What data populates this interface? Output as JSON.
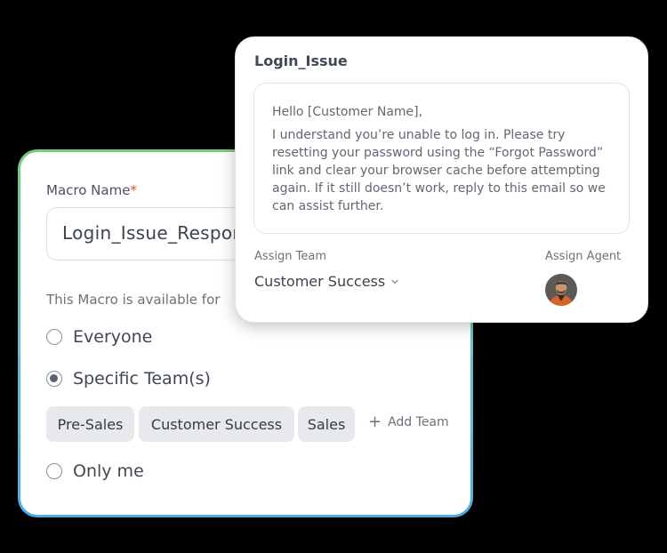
{
  "macro_form": {
    "name_label": "Macro Name",
    "required_mark": "*",
    "name_value": "Login_Issue_Response",
    "availability_label": "This Macro is available for",
    "options": [
      {
        "label": "Everyone",
        "selected": false
      },
      {
        "label": "Specific Team(s)",
        "selected": true
      },
      {
        "label": "Only me",
        "selected": false
      }
    ],
    "teams": [
      "Pre-Sales",
      "Customer Success",
      "Sales"
    ],
    "add_team_label": "Add Team"
  },
  "template": {
    "title": "Login_Issue",
    "greeting": "Hello [Customer Name],",
    "body": "I understand you’re unable to log in. Please try resetting your password using the “Forgot Password” link and clear your browser cache before attempting again. If it still doesn’t work, reply to this email so we can assist further.",
    "assign_team_label": "Assign Team",
    "assign_team_value": "Customer Success",
    "assign_agent_label": "Assign Agent"
  },
  "colors": {
    "background": "#000000",
    "card_border_gradient": [
      "#79c97a",
      "#6ac3c2",
      "#4eaee3"
    ],
    "required": "#e0503c",
    "chip_bg": "#e8e9ec"
  },
  "icons": [
    "plus-icon",
    "chevron-down-icon",
    "agent-avatar"
  ]
}
